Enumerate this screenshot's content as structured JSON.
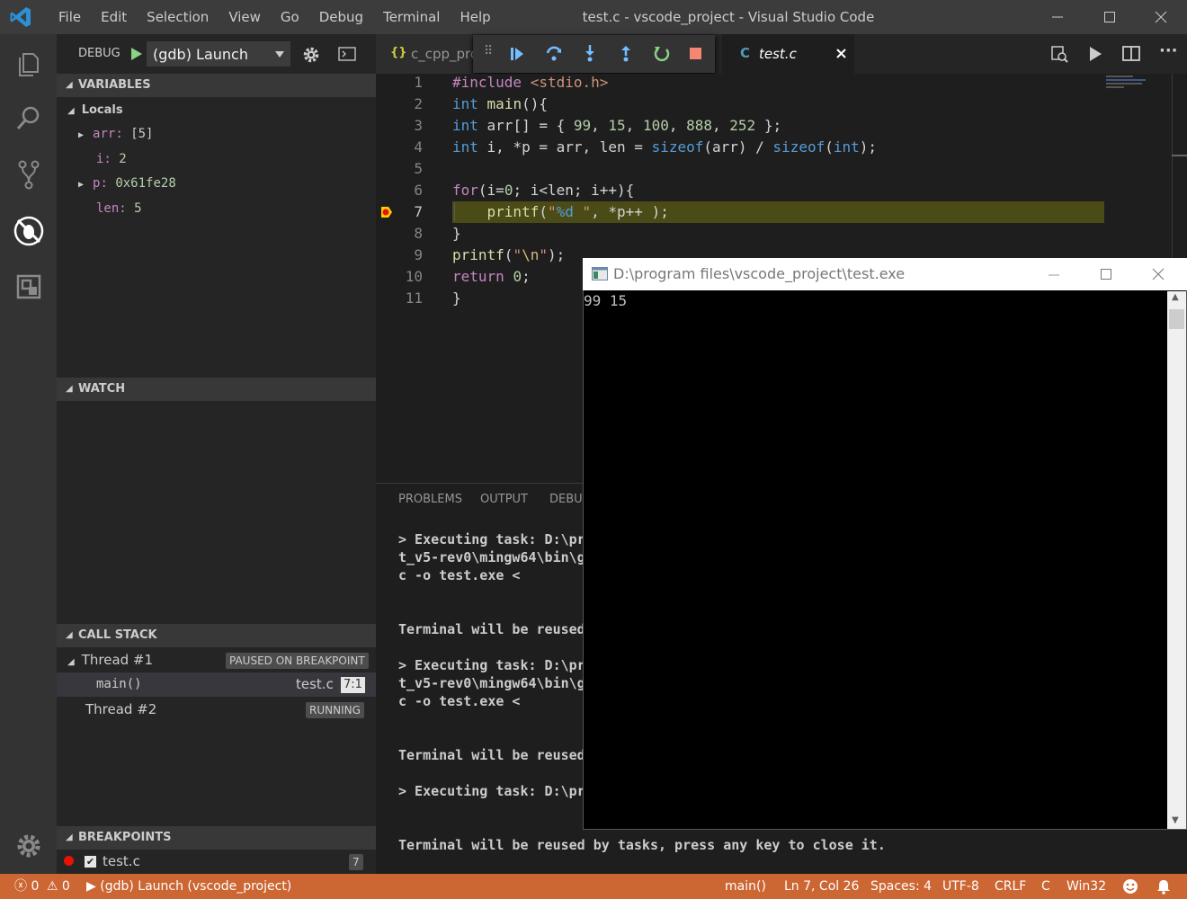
{
  "menu": [
    "File",
    "Edit",
    "Selection",
    "View",
    "Go",
    "Debug",
    "Terminal",
    "Help"
  ],
  "window_title": "test.c - vscode_project - Visual Studio Code",
  "debug": {
    "label": "DEBUG",
    "config": "(gdb) Launch"
  },
  "variables": {
    "header": "VARIABLES",
    "locals_label": "Locals",
    "items": [
      {
        "name": "arr:",
        "value": "[5]",
        "expandable": true
      },
      {
        "name": "i:",
        "value": "2",
        "expandable": false
      },
      {
        "name": "p:",
        "value": "0x61fe28",
        "expandable": true
      },
      {
        "name": "len:",
        "value": "5",
        "expandable": false
      }
    ]
  },
  "watch": {
    "header": "WATCH"
  },
  "call_stack": {
    "header": "CALL STACK",
    "thread1": "Thread #1",
    "thread1_status": "PAUSED ON BREAKPOINT",
    "frame_name": "main()",
    "frame_file": "test.c",
    "frame_pos": "7:1",
    "thread2": "Thread #2",
    "thread2_status": "RUNNING"
  },
  "breakpoints": {
    "header": "BREAKPOINTS",
    "file": "test.c",
    "line": "7"
  },
  "tabs": {
    "tab1": "c_cpp_pro",
    "tab1_icon": "{}",
    "tab2": "test.c",
    "tab2_icon": "C"
  },
  "code_lines": [
    "1",
    "2",
    "3",
    "4",
    "5",
    "6",
    "7",
    "8",
    "9",
    "10",
    "11"
  ],
  "panel": {
    "tabs": [
      "PROBLEMS",
      "OUTPUT",
      "DEBUG"
    ],
    "lines": [
      "> Executing task: D:\\pr",
      "t_v5-rev0\\mingw64\\bin\\g",
      "c -o test.exe <",
      "Terminal will be reused",
      "> Executing task: D:\\pr",
      "t_v5-rev0\\mingw64\\bin\\g",
      "c -o test.exe <",
      "Terminal will be reused",
      "> Executing task: D:\\pr",
      "Terminal will be reused by tasks, press any key to close it."
    ]
  },
  "console": {
    "title": "D:\\program files\\vscode_project\\test.exe",
    "output": "99 15"
  },
  "status": {
    "errors": "0",
    "warnings": "0",
    "debug_target": "(gdb) Launch (vscode_project)",
    "function": "main()",
    "position": "Ln 7, Col 26",
    "spaces": "Spaces: 4",
    "encoding": "UTF-8",
    "eol": "CRLF",
    "language": "C",
    "platform": "Win32"
  },
  "colors": {
    "statusbar": "#cc6633",
    "highlight": "#4b4b18",
    "breakpoint": "#e51400"
  }
}
